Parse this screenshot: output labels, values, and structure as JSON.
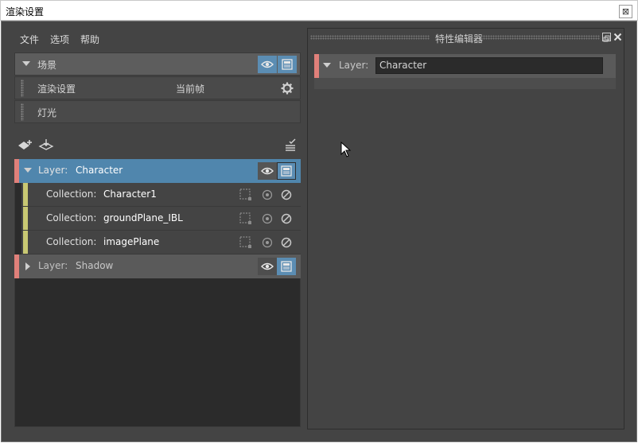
{
  "window": {
    "title": "渲染设置",
    "close_glyph": "⊠"
  },
  "menu": [
    "文件",
    "选项",
    "帮助"
  ],
  "scene": {
    "label": "场景",
    "render_settings": {
      "label": "渲染设置",
      "value": "当前帧"
    },
    "lights": {
      "label": "灯光"
    }
  },
  "layers": [
    {
      "prefix": "Layer:",
      "name": "Character",
      "expanded": true,
      "collections": [
        {
          "prefix": "Collection:",
          "name": "Character1"
        },
        {
          "prefix": "Collection:",
          "name": "groundPlane_IBL"
        },
        {
          "prefix": "Collection:",
          "name": "imagePlane"
        }
      ]
    },
    {
      "prefix": "Layer:",
      "name": "Shadow",
      "expanded": false,
      "collections": []
    }
  ],
  "attribute_editor": {
    "title": "特性编辑器",
    "layer_prefix": "Layer:",
    "layer_value": "Character"
  },
  "colors": {
    "selected_row": "#5086ad",
    "layer_marker": "#e0807a",
    "collection_marker": "#c8c873",
    "icon_active_bg": "#5b8db3"
  }
}
